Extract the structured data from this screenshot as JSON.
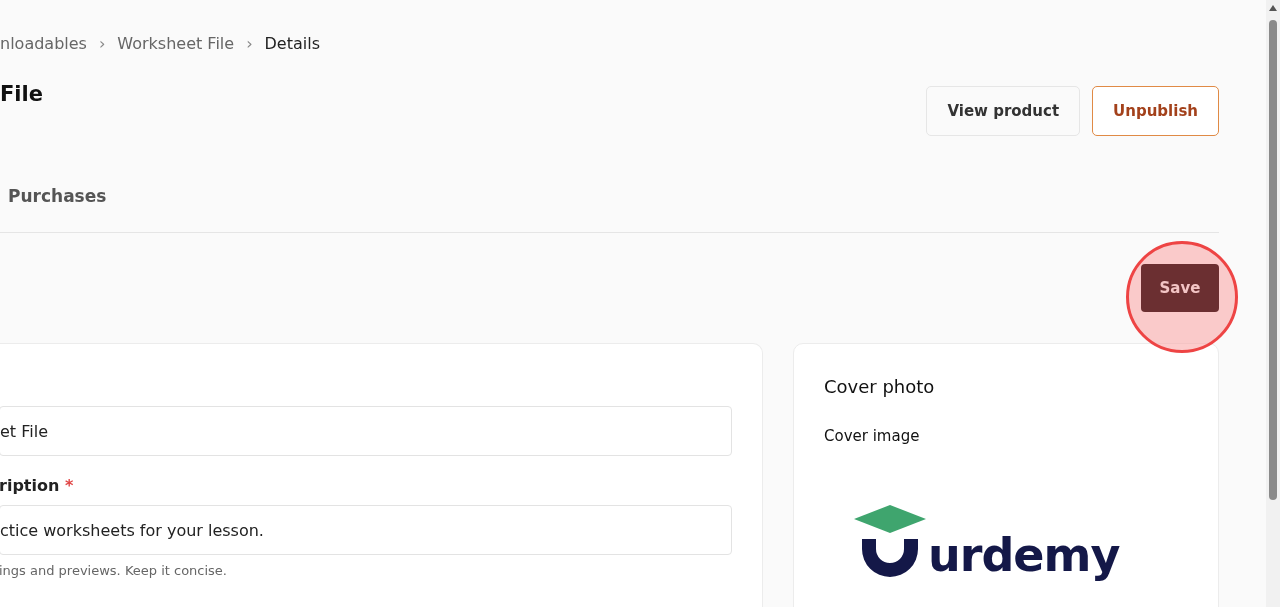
{
  "breadcrumb": [
    {
      "label": "nloadables",
      "current": false
    },
    {
      "label": "Worksheet File",
      "current": false
    },
    {
      "label": "Details",
      "current": true
    }
  ],
  "breadcrumb_separator": "›",
  "page_title": "File",
  "header_buttons": [
    {
      "label": "View product",
      "kind": "secondary"
    },
    {
      "label": "Unpublish",
      "kind": "outline"
    }
  ],
  "tabs": [
    {
      "label": "Purchases",
      "selected": false
    }
  ],
  "save_button": {
    "label": "Save",
    "highlighted": true
  },
  "form": {
    "fields": [
      {
        "value": "et File"
      },
      {
        "label": "ription",
        "required_mark": "*",
        "value": "ctice worksheets for your lesson.",
        "hint": "ings and previews. Keep it concise."
      }
    ]
  },
  "cover_card": {
    "title": "Cover photo",
    "image_label": "Cover image",
    "logo_text": "urdemy"
  }
}
